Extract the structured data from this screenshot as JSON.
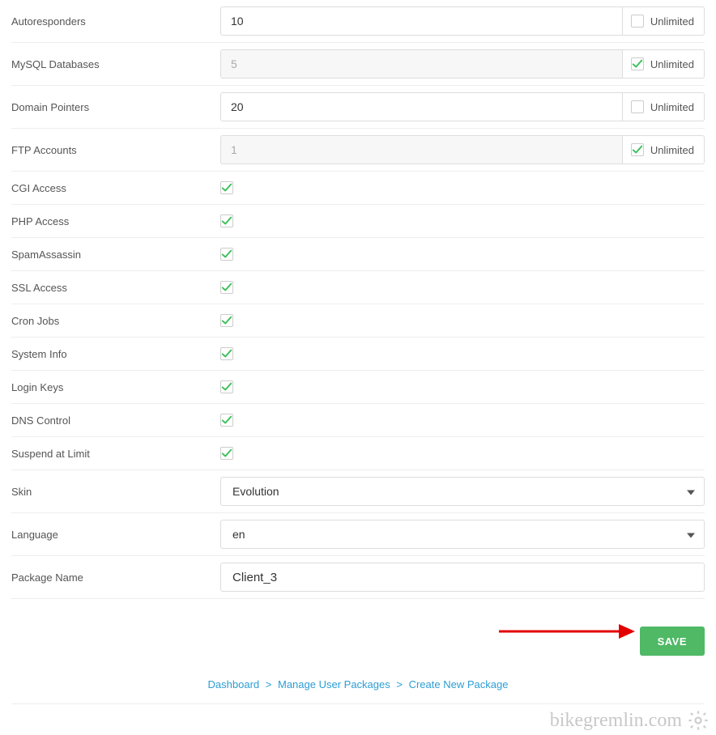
{
  "rows": {
    "autoresponders": {
      "label": "Autoresponders",
      "value": "10",
      "unlimited_label": "Unlimited",
      "unlimited_checked": false,
      "disabled": false
    },
    "mysql": {
      "label": "MySQL Databases",
      "value": "5",
      "unlimited_label": "Unlimited",
      "unlimited_checked": true,
      "disabled": true
    },
    "pointers": {
      "label": "Domain Pointers",
      "value": "20",
      "unlimited_label": "Unlimited",
      "unlimited_checked": false,
      "disabled": false
    },
    "ftp": {
      "label": "FTP Accounts",
      "value": "1",
      "unlimited_label": "Unlimited",
      "unlimited_checked": true,
      "disabled": true
    }
  },
  "toggles": {
    "cgi": {
      "label": "CGI Access",
      "checked": true
    },
    "php": {
      "label": "PHP Access",
      "checked": true
    },
    "spam": {
      "label": "SpamAssassin",
      "checked": true
    },
    "ssl": {
      "label": "SSL Access",
      "checked": true
    },
    "cron": {
      "label": "Cron Jobs",
      "checked": true
    },
    "sysinfo": {
      "label": "System Info",
      "checked": true
    },
    "loginkeys": {
      "label": "Login Keys",
      "checked": true
    },
    "dns": {
      "label": "DNS Control",
      "checked": true
    },
    "suspend": {
      "label": "Suspend at Limit",
      "checked": true
    }
  },
  "selects": {
    "skin": {
      "label": "Skin",
      "value": "Evolution"
    },
    "language": {
      "label": "Language",
      "value": "en"
    }
  },
  "package": {
    "label": "Package Name",
    "value": "Client_3"
  },
  "save_label": "SAVE",
  "breadcrumb": {
    "dashboard": "Dashboard",
    "manage": "Manage User Packages",
    "create": "Create New Package",
    "sep": ">"
  },
  "watermark": "bikegremlin.com"
}
